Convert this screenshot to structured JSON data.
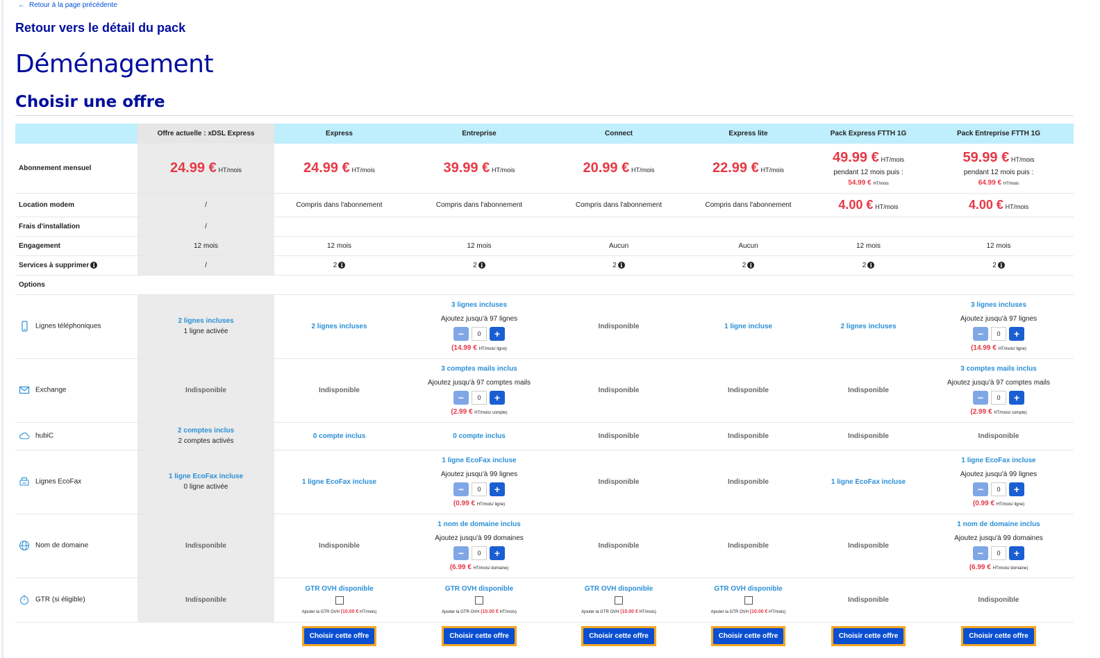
{
  "nav": {
    "back_arrow": "←",
    "back_label": "Retour à la page précédente",
    "pack_back": "Retour vers le détail du pack"
  },
  "page": {
    "title": "Déménagement",
    "subtitle": "Choisir une offre"
  },
  "columns": [
    {
      "name": "Offre actuelle : xDSL Express"
    },
    {
      "name": "Express"
    },
    {
      "name": "Entreprise"
    },
    {
      "name": "Connect"
    },
    {
      "name": "Express lite"
    },
    {
      "name": "Pack Express FTTH 1G"
    },
    {
      "name": "Pack Entreprise FTTH 1G"
    }
  ],
  "rows": {
    "abonnement": {
      "label": "Abonnement mensuel",
      "unit": "HT/mois",
      "prices": [
        "24.99 €",
        "24.99 €",
        "39.99 €",
        "20.99 €",
        "22.99 €",
        "49.99 €",
        "59.99 €"
      ],
      "promo_text": "pendant 12 mois puis :",
      "after_prices": {
        "5": "54.99 €",
        "6": "64.99 €"
      }
    },
    "modem": {
      "label": "Location modem",
      "values": [
        "/",
        "Compris dans l'abonnement",
        "Compris dans l'abonnement",
        "Compris dans l'abonnement",
        "Compris dans l'abonnement",
        "4.00 €",
        "4.00 €"
      ],
      "unit": "HT/mois"
    },
    "frais": {
      "label": "Frais d'installation",
      "values": [
        "/",
        "",
        "",
        "",
        "",
        "",
        ""
      ]
    },
    "engagement": {
      "label": "Engagement",
      "values": [
        "12 mois",
        "12 mois",
        "12 mois",
        "Aucun",
        "Aucun",
        "12 mois",
        "12 mois"
      ]
    },
    "services": {
      "label": "Services à supprimer",
      "values": [
        "/",
        "2",
        "2",
        "2",
        "2",
        "2",
        "2"
      ]
    },
    "options_label": "Options"
  },
  "options": {
    "lignes": {
      "label": "Lignes téléphoniques",
      "current": {
        "included": "2 lignes incluses",
        "active": "1 ligne activée"
      },
      "express": "2 lignes incluses",
      "entreprise": {
        "included": "3 lignes incluses",
        "add": "Ajoutez jusqu'à 97 lignes",
        "value": "0",
        "price": "14.99 €",
        "unit": "HT/mois/ ligne"
      },
      "connect": "Indisponible",
      "express_lite": "1 ligne incluse",
      "ftth_express": "2 lignes incluses",
      "ftth_entreprise": {
        "included": "3 lignes incluses",
        "add": "Ajoutez jusqu'à 97 lignes",
        "value": "0",
        "price": "14.99 €",
        "unit": "HT/mois/ ligne"
      }
    },
    "exchange": {
      "label": "Exchange",
      "current": "Indisponible",
      "express": "Indisponible",
      "entreprise": {
        "included": "3 comptes mails inclus",
        "add": "Ajoutez jusqu'à 97 comptes mails",
        "value": "0",
        "price": "2.99 €",
        "unit": "HT/mois/ compte"
      },
      "connect": "Indisponible",
      "express_lite": "Indisponible",
      "ftth_express": "Indisponible",
      "ftth_entreprise": {
        "included": "3 comptes mails inclus",
        "add": "Ajoutez jusqu'à 97 comptes mails",
        "value": "0",
        "price": "2.99 €",
        "unit": "HT/mois/ compte"
      }
    },
    "hubic": {
      "label": "hubiC",
      "current": {
        "included": "2 comptes inclus",
        "active": "2 comptes activés"
      },
      "express": "0 compte inclus",
      "entreprise": "0 compte inclus",
      "connect": "Indisponible",
      "express_lite": "Indisponible",
      "ftth_express": "Indisponible",
      "ftth_entreprise": "Indisponible"
    },
    "ecofax": {
      "label": "Lignes EcoFax",
      "current": {
        "included": "1 ligne EcoFax incluse",
        "active": "0 ligne activée"
      },
      "express": "1 ligne EcoFax incluse",
      "entreprise": {
        "included": "1 ligne EcoFax incluse",
        "add": "Ajoutez jusqu'à 99 lignes",
        "value": "0",
        "price": "0.99 €",
        "unit": "HT/mois/ ligne"
      },
      "connect": "Indisponible",
      "express_lite": "Indisponible",
      "ftth_express": "1 ligne EcoFax incluse",
      "ftth_entreprise": {
        "included": "1 ligne EcoFax incluse",
        "add": "Ajoutez jusqu'à 99 lignes",
        "value": "0",
        "price": "0.99 €",
        "unit": "HT/mois/ ligne"
      }
    },
    "domaine": {
      "label": "Nom de domaine",
      "current": "Indisponible",
      "express": "Indisponible",
      "entreprise": {
        "included": "1 nom de domaine inclus",
        "add": "Ajoutez jusqu'à 99 domaines",
        "value": "0",
        "price": "6.99 €",
        "unit": "HT/mois/ domaine"
      },
      "connect": "Indisponible",
      "express_lite": "Indisponible",
      "ftth_express": "Indisponible",
      "ftth_entreprise": {
        "included": "1 nom de domaine inclus",
        "add": "Ajoutez jusqu'à 99 domaines",
        "value": "0",
        "price": "6.99 €",
        "unit": "HT/mois/ domaine"
      }
    },
    "gtr": {
      "label": "GTR (si éligible)",
      "current": "Indisponible",
      "available": "GTR OVH disponible",
      "add_text": "Ajouter la GTR OVH",
      "price": "10.00 €",
      "unit": "HT/mois",
      "unavailable": "Indisponible"
    }
  },
  "actions": {
    "choose_label": "Choisir cette offre"
  },
  "colors": {
    "accent": "#0a4fd1",
    "header": "#bfeefc",
    "price": "#e63946",
    "link": "#2a8fd6",
    "highlight": "#f5a623"
  }
}
